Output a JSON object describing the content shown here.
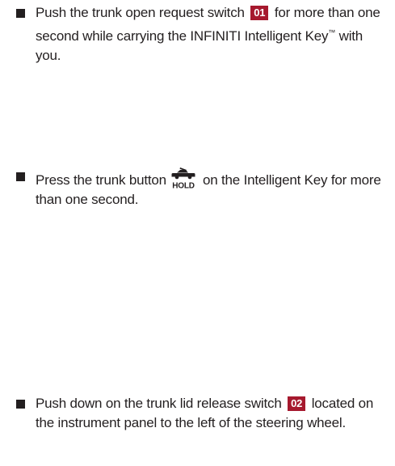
{
  "items": [
    {
      "before": "Push the trunk open request switch",
      "badge": "01",
      "after": "for more than one second while carrying the INFINITI Intelligent Key",
      "tm": "™",
      "end": " with you."
    },
    {
      "before": "Press the trunk button",
      "icon_name": "trunk-hold-icon",
      "icon_label": "HOLD",
      "after": "on the Intelligent Key for more than one second."
    },
    {
      "before": "Push down on the trunk lid release switch",
      "badge": "02",
      "after": "located on the instrument panel to the left of the steering wheel."
    }
  ],
  "colors": {
    "text": "#231f20",
    "badge_bg": "#a6192e",
    "badge_text": "#ffffff"
  }
}
